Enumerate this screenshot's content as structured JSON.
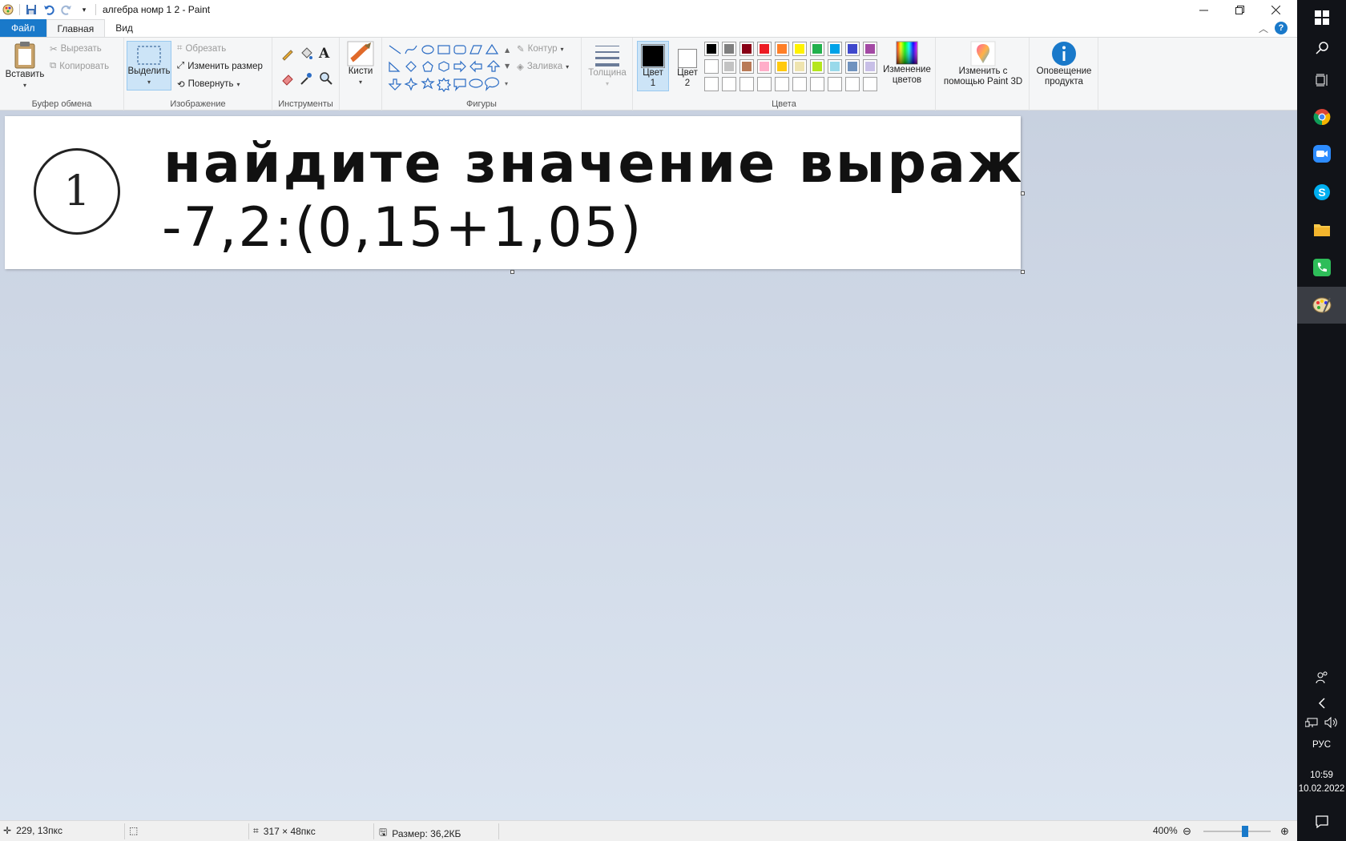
{
  "window": {
    "title": "алгебра номр 1 2 - Paint"
  },
  "tabs": {
    "file": "Файл",
    "home": "Главная",
    "view": "Вид"
  },
  "ribbon": {
    "clipboard": {
      "label": "Буфер обмена",
      "paste": "Вставить",
      "cut": "Вырезать",
      "copy": "Копировать"
    },
    "image": {
      "label": "Изображение",
      "select": "Выделить",
      "crop": "Обрезать",
      "resize": "Изменить размер",
      "rotate": "Повернуть"
    },
    "tools": {
      "label": "Инструменты"
    },
    "brushes": {
      "label": "Кисти"
    },
    "shapes": {
      "label": "Фигуры",
      "outline": "Контур",
      "fill": "Заливка"
    },
    "size": {
      "label": "Толщина"
    },
    "colors": {
      "label": "Цвета",
      "color1_line1": "Цвет",
      "color1_line2": "1",
      "color2_line1": "Цвет",
      "color2_line2": "2",
      "edit_line1": "Изменение",
      "edit_line2": "цветов",
      "color1_value": "#000000",
      "color2_value": "#ffffff",
      "palette_row1": [
        "#000000",
        "#7f7f7f",
        "#880015",
        "#ed1c24",
        "#ff7f27",
        "#fff200",
        "#22b14c",
        "#00a2e8",
        "#3f48cc",
        "#a349a4"
      ],
      "palette_row2": [
        "#ffffff",
        "#c3c3c3",
        "#b97a57",
        "#ffaec9",
        "#ffc90e",
        "#efe4b0",
        "#b5e61d",
        "#99d9ea",
        "#7092be",
        "#c8bfe7"
      ]
    },
    "paint3d": {
      "line1": "Изменить с",
      "line2": "помощью Paint 3D"
    },
    "notice": {
      "line1": "Оповещение",
      "line2": "продукта"
    }
  },
  "canvas": {
    "circle_number": "1",
    "line1": "найдите значение выражения",
    "line2": "-7,2:(0,15+1,05)"
  },
  "status": {
    "cursor": "229, 13пкс",
    "dimensions": "317 × 48пкс",
    "filesize": "Размер: 36,2КБ",
    "zoom": "400%",
    "zoom_fraction": 0.62
  },
  "taskbar": {
    "lang": "РУС",
    "time": "10:59",
    "date": "10.02.2022"
  }
}
